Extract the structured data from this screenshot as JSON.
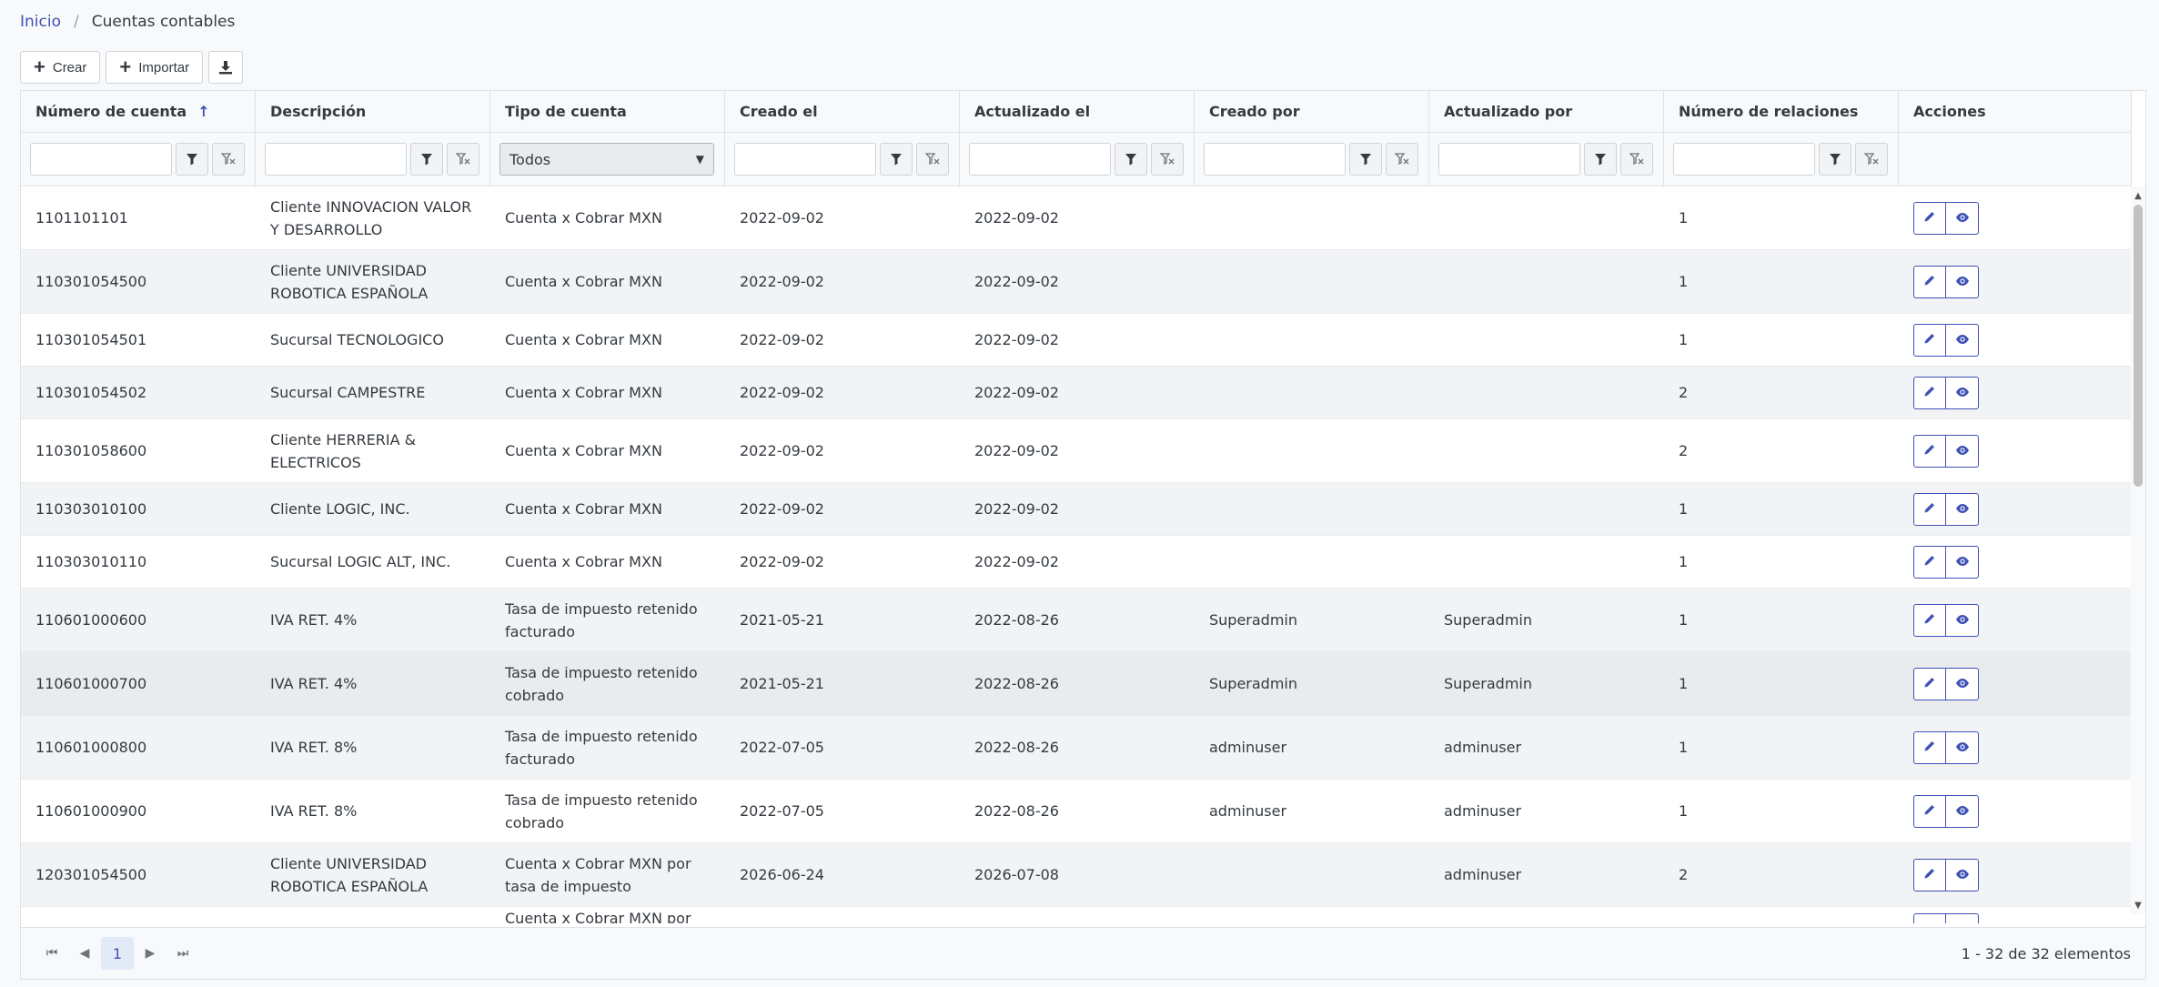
{
  "breadcrumb": {
    "home": "Inicio",
    "separator": "/",
    "current": "Cuentas contables"
  },
  "toolbar": {
    "create": "Crear",
    "import": "Importar"
  },
  "table": {
    "columns": [
      "Número de cuenta",
      "Descripción",
      "Tipo de cuenta",
      "Creado el",
      "Actualizado el",
      "Creado por",
      "Actualizado por",
      "Número de relaciones",
      "Acciones"
    ],
    "sort_indicator": "↑",
    "type_filter_value": "Todos",
    "rows": [
      [
        "1101101101",
        "Cliente INNOVACION VALOR Y DESARROLLO",
        "Cuenta x Cobrar MXN",
        "2022-09-02",
        "2022-09-02",
        "",
        "",
        "1"
      ],
      [
        "110301054500",
        "Cliente UNIVERSIDAD ROBOTICA ESPAÑOLA",
        "Cuenta x Cobrar MXN",
        "2022-09-02",
        "2022-09-02",
        "",
        "",
        "1"
      ],
      [
        "110301054501",
        "Sucursal TECNOLOGICO",
        "Cuenta x Cobrar MXN",
        "2022-09-02",
        "2022-09-02",
        "",
        "",
        "1"
      ],
      [
        "110301054502",
        "Sucursal CAMPESTRE",
        "Cuenta x Cobrar MXN",
        "2022-09-02",
        "2022-09-02",
        "",
        "",
        "2"
      ],
      [
        "110301058600",
        "Cliente HERRERIA & ELECTRICOS",
        "Cuenta x Cobrar MXN",
        "2022-09-02",
        "2022-09-02",
        "",
        "",
        "2"
      ],
      [
        "110303010100",
        "Cliente LOGIC, INC.",
        "Cuenta x Cobrar MXN",
        "2022-09-02",
        "2022-09-02",
        "",
        "",
        "1"
      ],
      [
        "110303010110",
        "Sucursal LOGIC ALT, INC.",
        "Cuenta x Cobrar MXN",
        "2022-09-02",
        "2022-09-02",
        "",
        "",
        "1"
      ],
      [
        "110601000600",
        "IVA RET. 4%",
        "Tasa de impuesto retenido facturado",
        "2021-05-21",
        "2022-08-26",
        "Superadmin",
        "Superadmin",
        "1"
      ],
      [
        "110601000700",
        "IVA RET. 4%",
        "Tasa de impuesto retenido cobrado",
        "2021-05-21",
        "2022-08-26",
        "Superadmin",
        "Superadmin",
        "1"
      ],
      [
        "110601000800",
        "IVA RET. 8%",
        "Tasa de impuesto retenido facturado",
        "2022-07-05",
        "2022-08-26",
        "adminuser",
        "adminuser",
        "1"
      ],
      [
        "110601000900",
        "IVA RET. 8%",
        "Tasa de impuesto retenido cobrado",
        "2022-07-05",
        "2022-08-26",
        "adminuser",
        "adminuser",
        "1"
      ],
      [
        "120301054500",
        "Cliente UNIVERSIDAD ROBOTICA ESPAÑOLA",
        "Cuenta x Cobrar MXN por tasa de impuesto",
        "2026-06-24",
        "2026-07-08",
        "",
        "adminuser",
        "2"
      ],
      [
        "",
        "",
        "Cuenta x Cobrar MXN por tasa de impuesto",
        "",
        "",
        "",
        "",
        ""
      ]
    ]
  },
  "paginator": {
    "current_page": "1",
    "summary": "1 - 32 de 32 elementos"
  },
  "colors": {
    "accent": "#3f51b5",
    "border": "#dee2e6",
    "row_alt": "#f1f3f5"
  }
}
